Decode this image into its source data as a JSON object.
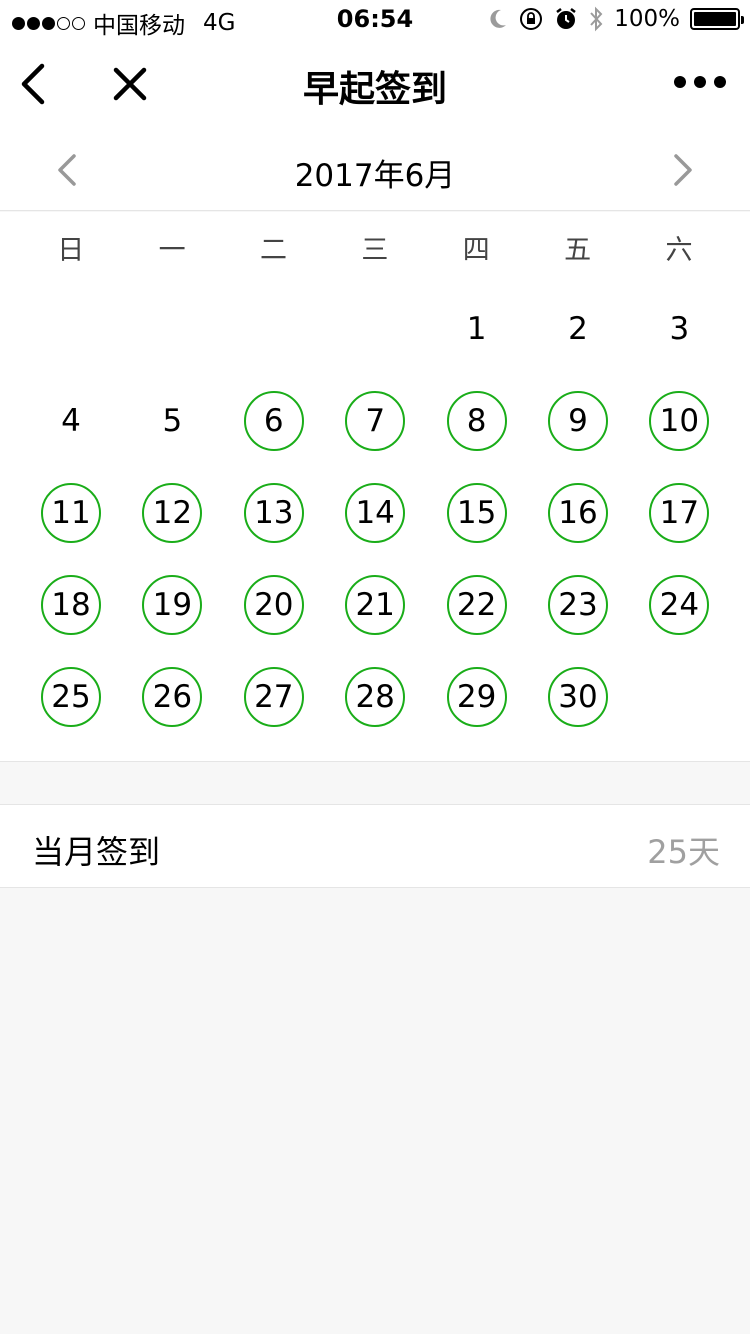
{
  "status_bar": {
    "carrier": "中国移动",
    "network": "4G",
    "time": "06:54",
    "battery": "100%"
  },
  "nav": {
    "title": "早起签到"
  },
  "calendar": {
    "month_label": "2017年6月",
    "weekdays": [
      "日",
      "一",
      "二",
      "三",
      "四",
      "五",
      "六"
    ],
    "first_weekday_index": 4,
    "days_in_month": 30,
    "checked_days": [
      6,
      7,
      8,
      9,
      10,
      11,
      12,
      13,
      14,
      15,
      16,
      17,
      18,
      19,
      20,
      21,
      22,
      23,
      24,
      25,
      26,
      27,
      28,
      29,
      30
    ],
    "checked_color": "#1aad19"
  },
  "summary": {
    "label": "当月签到",
    "value": "25天"
  }
}
